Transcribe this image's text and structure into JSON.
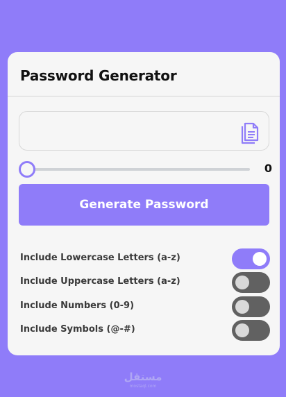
{
  "app": {
    "title": "Password Generator"
  },
  "password_output": {
    "value": "",
    "copy_icon": "copy-icon"
  },
  "length_slider": {
    "value": 0,
    "value_label": "0"
  },
  "generate_button": {
    "label": "Generate Password"
  },
  "options": [
    {
      "label": "Include Lowercase Letters (a-z)",
      "enabled": true
    },
    {
      "label": "Include Uppercase Letters (a-z)",
      "enabled": false
    },
    {
      "label": "Include Numbers (0-9)",
      "enabled": false
    },
    {
      "label": "Include Symbols (@-#)",
      "enabled": false
    }
  ],
  "watermark": {
    "text": "مستقل",
    "sub": "mostaql.com"
  },
  "colors": {
    "accent": "#8f7cf9",
    "toggle_off": "#616161",
    "card": "#f6f6f6"
  }
}
